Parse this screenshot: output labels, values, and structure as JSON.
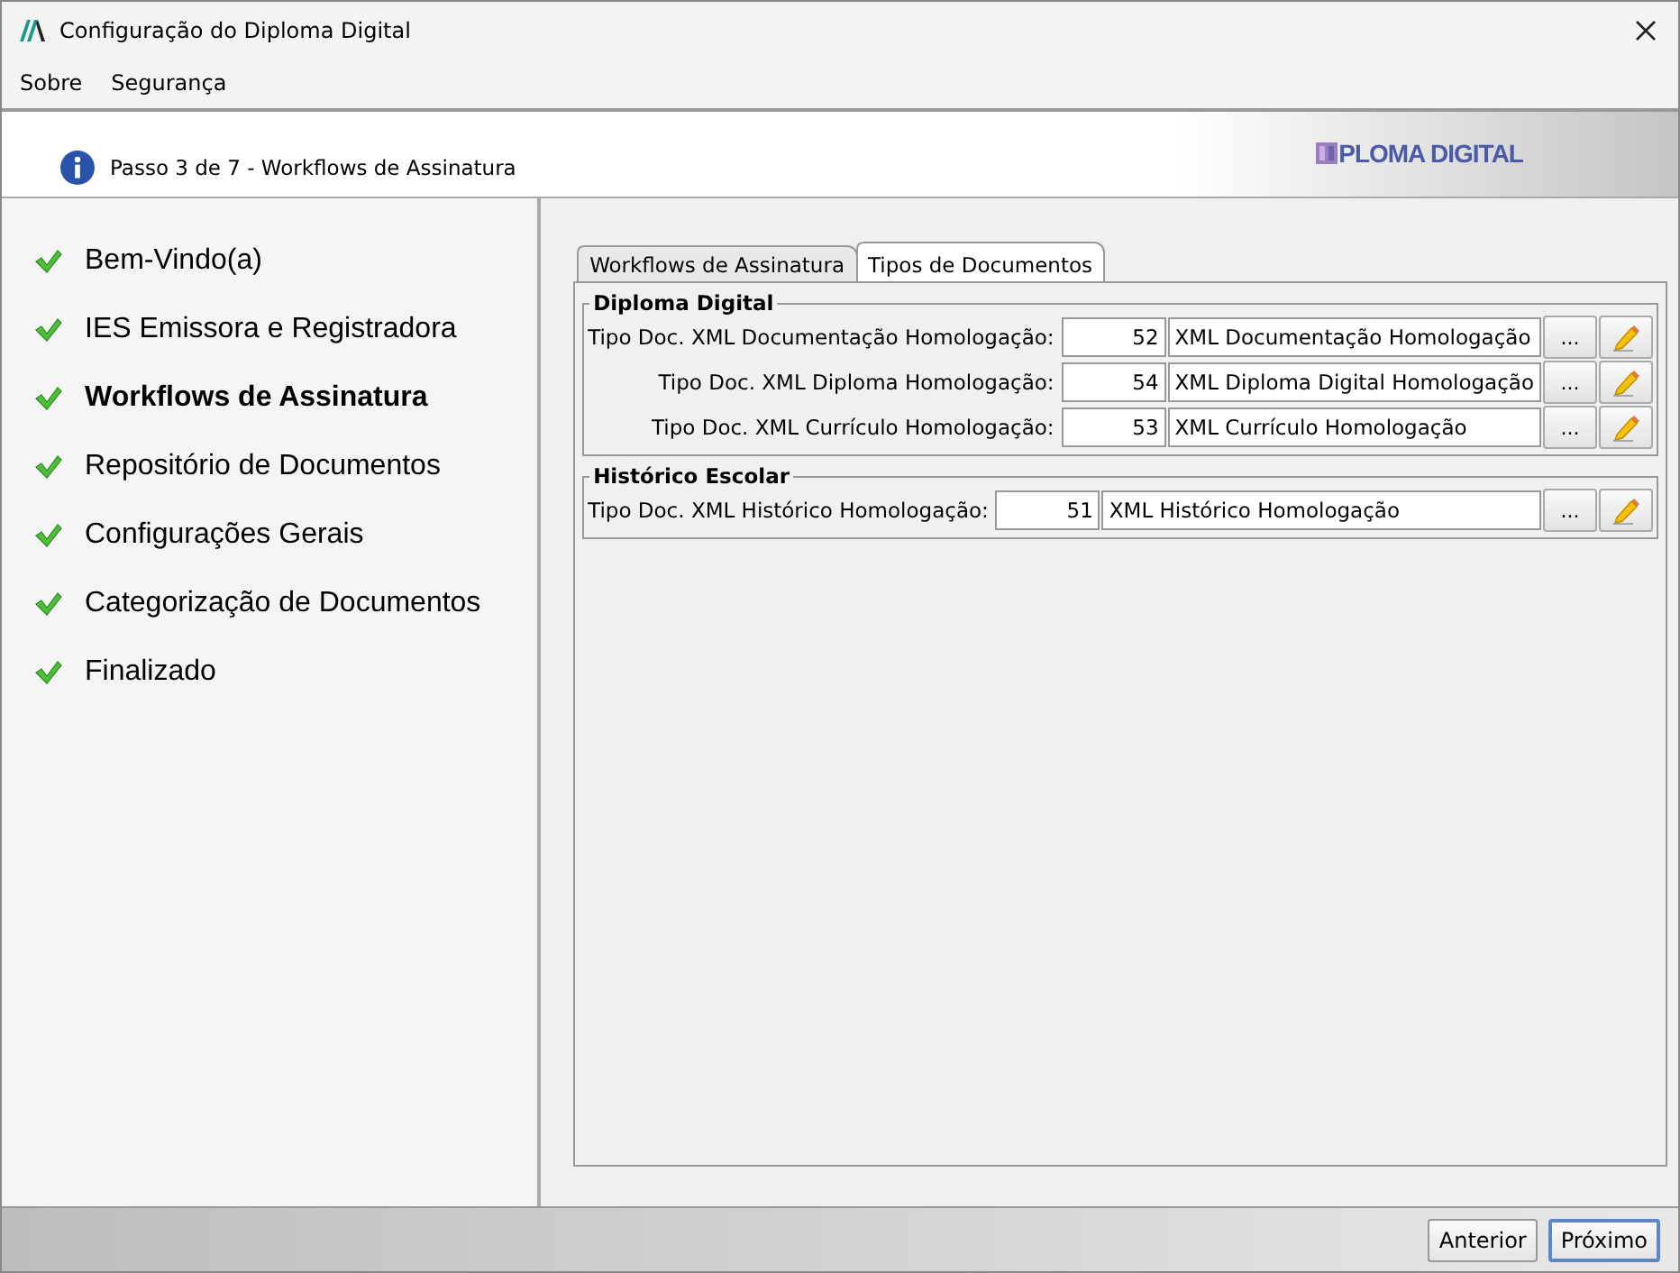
{
  "window": {
    "title": "Configuração do Diploma Digital"
  },
  "menu": [
    "Sobre",
    "Segurança"
  ],
  "header": {
    "step": "Passo 3 de 7 - Workflows de Assinatura",
    "logo": "PLOMA DIGITAL"
  },
  "steps": [
    {
      "label": "Bem-Vindo(a)",
      "done": true,
      "selected": false
    },
    {
      "label": "IES Emissora e Registradora",
      "done": true,
      "selected": false
    },
    {
      "label": "Workflows de Assinatura",
      "done": true,
      "selected": true
    },
    {
      "label": "Repositório de Documentos",
      "done": true,
      "selected": false
    },
    {
      "label": "Configurações Gerais",
      "done": true,
      "selected": false
    },
    {
      "label": "Categorização de Documentos",
      "done": true,
      "selected": false
    },
    {
      "label": "Finalizado",
      "done": true,
      "selected": false
    }
  ],
  "tabs": [
    {
      "label": "Workflows de Assinatura",
      "selected": false
    },
    {
      "label": "Tipos de Documentos",
      "selected": true
    }
  ],
  "groups": [
    {
      "title": "Diploma Digital",
      "rows": [
        {
          "label": "Tipo Doc. XML Documentação Homologação:",
          "code": "52",
          "name": "XML Documentação Homologação",
          "browse": "..."
        },
        {
          "label": "Tipo Doc. XML Diploma Homologação:",
          "code": "54",
          "name": "XML Diploma Digital Homologação",
          "browse": "..."
        },
        {
          "label": "Tipo Doc. XML Currículo Homologação:",
          "code": "53",
          "name": "XML Currículo Homologação",
          "browse": "..."
        }
      ]
    },
    {
      "title": "Histórico Escolar",
      "rows": [
        {
          "label": "Tipo Doc. XML Histórico Homologação:",
          "code": "51",
          "name": "XML Histórico Homologação",
          "browse": "..."
        }
      ]
    }
  ],
  "buttons": [
    {
      "label": "Anterior",
      "focused": false
    },
    {
      "label": "Próximo",
      "focused": true
    }
  ]
}
